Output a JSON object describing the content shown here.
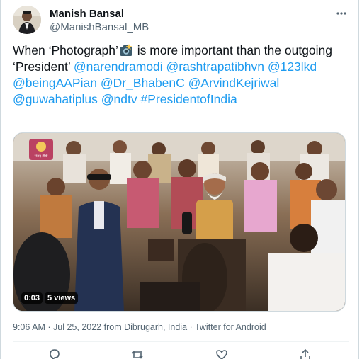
{
  "tweet": {
    "display_name": "Manish Bansal",
    "handle": "@ManishBansal_MB",
    "text_before_emoji": "When ‘Photograph’",
    "text_after_emoji": " is more important than the outgoing ‘President’ ",
    "mentions": [
      "@narendramodi",
      "@rashtrapatibhvn",
      "@123lkd",
      "@beingAAPian",
      "@Dr_BhabenC",
      "@ArvindKejriwal",
      "@guwahatiplus",
      "@ndtv",
      "#PresidentofIndia"
    ],
    "emoji_icon": "camera-flash-emoji"
  },
  "video": {
    "duration": "0:03",
    "views": "5 views",
    "channel_logo_text": "संसद टीवी"
  },
  "meta": {
    "time": "9:06 AM",
    "date": "Jul 25, 2022",
    "location": "from Dibrugarh, India",
    "client": "Twitter for Android",
    "sep": "·"
  },
  "actions": {
    "icons": [
      "reply-icon",
      "retweet-icon",
      "like-icon",
      "share-icon"
    ]
  },
  "colors": {
    "link": "#1d9bf0",
    "text": "#0f1419",
    "secondary": "#536471"
  }
}
